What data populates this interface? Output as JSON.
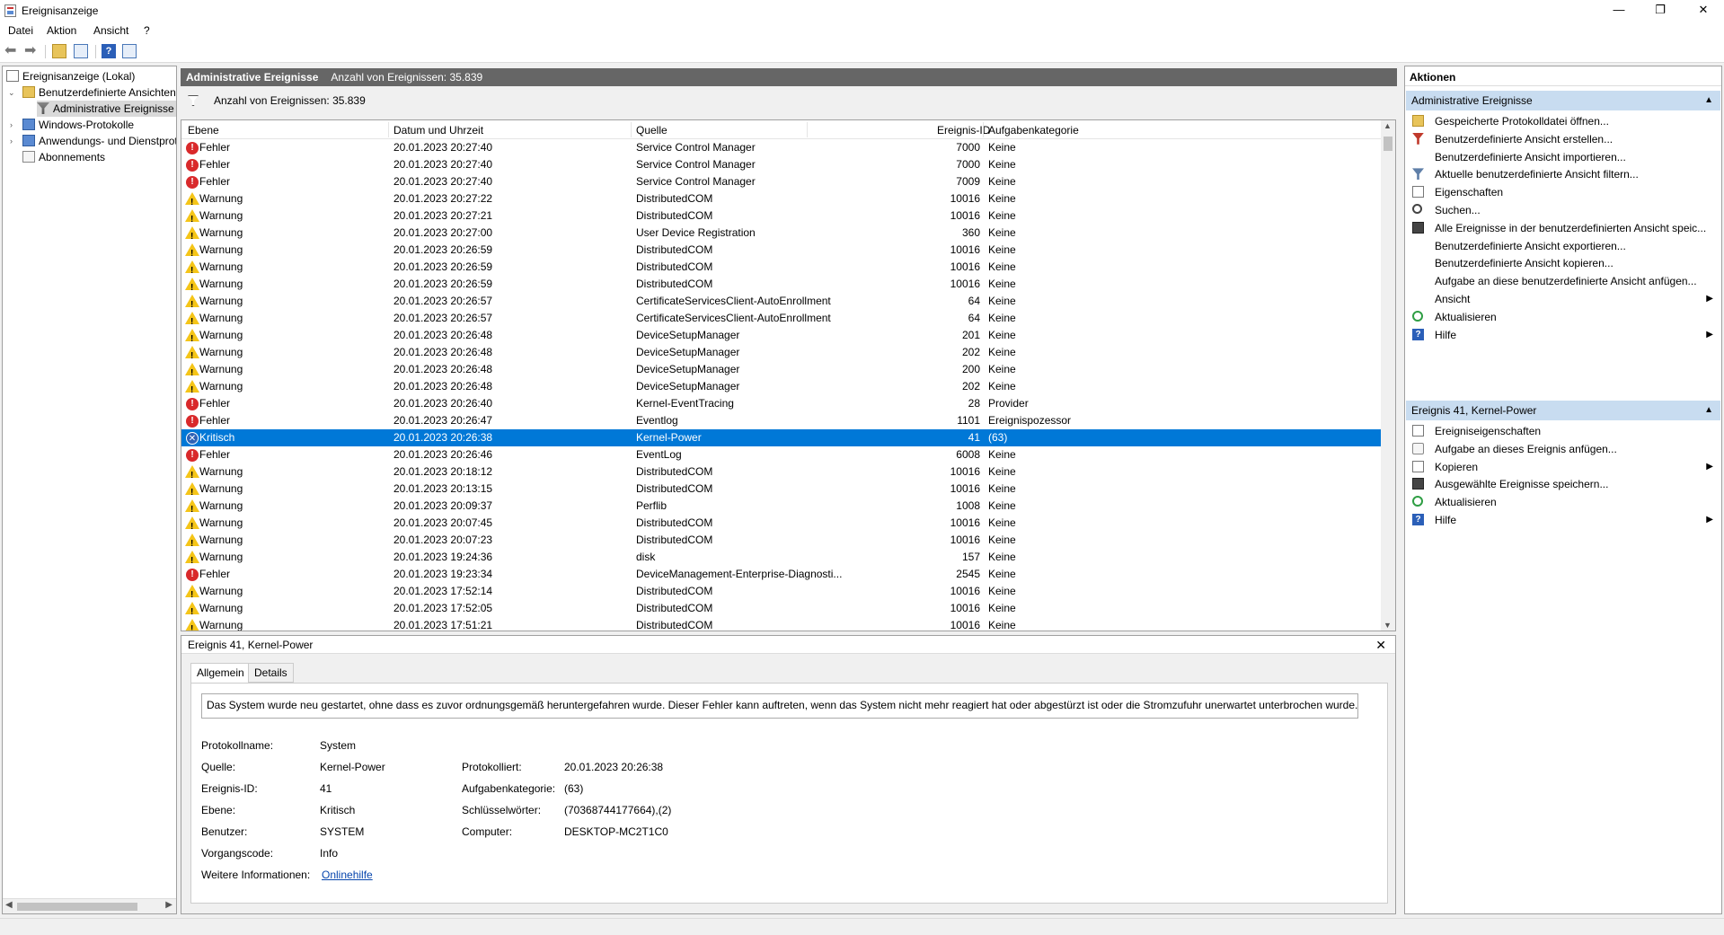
{
  "window": {
    "title": "Ereignisanzeige",
    "minimize": "—",
    "maximize": "❐",
    "close": "✕"
  },
  "menu": [
    "Datei",
    "Aktion",
    "Ansicht",
    "?"
  ],
  "tree": {
    "root": "Ereignisanzeige (Lokal)",
    "custom_views": "Benutzerdefinierte Ansichten",
    "admin_events": "Administrative Ereignisse",
    "windows_logs": "Windows-Protokolle",
    "app_logs": "Anwendungs- und Dienstprotokolle",
    "subscriptions": "Abonnements"
  },
  "center": {
    "header_title": "Administrative Ereignisse",
    "header_count": "Anzahl von Ereignissen: 35.839",
    "filter_text": "Anzahl von Ereignissen: 35.839",
    "columns": [
      "Ebene",
      "Datum und Uhrzeit",
      "Quelle",
      "Ereignis-ID",
      "Aufgabenkategorie"
    ],
    "rows": [
      {
        "level": "Fehler",
        "type": "err",
        "date": "20.01.2023 20:27:40",
        "source": "Service Control Manager",
        "id": "7000",
        "cat": "Keine"
      },
      {
        "level": "Fehler",
        "type": "err",
        "date": "20.01.2023 20:27:40",
        "source": "Service Control Manager",
        "id": "7000",
        "cat": "Keine"
      },
      {
        "level": "Fehler",
        "type": "err",
        "date": "20.01.2023 20:27:40",
        "source": "Service Control Manager",
        "id": "7009",
        "cat": "Keine"
      },
      {
        "level": "Warnung",
        "type": "warn",
        "date": "20.01.2023 20:27:22",
        "source": "DistributedCOM",
        "id": "10016",
        "cat": "Keine"
      },
      {
        "level": "Warnung",
        "type": "warn",
        "date": "20.01.2023 20:27:21",
        "source": "DistributedCOM",
        "id": "10016",
        "cat": "Keine"
      },
      {
        "level": "Warnung",
        "type": "warn",
        "date": "20.01.2023 20:27:00",
        "source": "User Device Registration",
        "id": "360",
        "cat": "Keine"
      },
      {
        "level": "Warnung",
        "type": "warn",
        "date": "20.01.2023 20:26:59",
        "source": "DistributedCOM",
        "id": "10016",
        "cat": "Keine"
      },
      {
        "level": "Warnung",
        "type": "warn",
        "date": "20.01.2023 20:26:59",
        "source": "DistributedCOM",
        "id": "10016",
        "cat": "Keine"
      },
      {
        "level": "Warnung",
        "type": "warn",
        "date": "20.01.2023 20:26:59",
        "source": "DistributedCOM",
        "id": "10016",
        "cat": "Keine"
      },
      {
        "level": "Warnung",
        "type": "warn",
        "date": "20.01.2023 20:26:57",
        "source": "CertificateServicesClient-AutoEnrollment",
        "id": "64",
        "cat": "Keine"
      },
      {
        "level": "Warnung",
        "type": "warn",
        "date": "20.01.2023 20:26:57",
        "source": "CertificateServicesClient-AutoEnrollment",
        "id": "64",
        "cat": "Keine"
      },
      {
        "level": "Warnung",
        "type": "warn",
        "date": "20.01.2023 20:26:48",
        "source": "DeviceSetupManager",
        "id": "201",
        "cat": "Keine"
      },
      {
        "level": "Warnung",
        "type": "warn",
        "date": "20.01.2023 20:26:48",
        "source": "DeviceSetupManager",
        "id": "202",
        "cat": "Keine"
      },
      {
        "level": "Warnung",
        "type": "warn",
        "date": "20.01.2023 20:26:48",
        "source": "DeviceSetupManager",
        "id": "200",
        "cat": "Keine"
      },
      {
        "level": "Warnung",
        "type": "warn",
        "date": "20.01.2023 20:26:48",
        "source": "DeviceSetupManager",
        "id": "202",
        "cat": "Keine"
      },
      {
        "level": "Fehler",
        "type": "err",
        "date": "20.01.2023 20:26:40",
        "source": "Kernel-EventTracing",
        "id": "28",
        "cat": "Provider"
      },
      {
        "level": "Fehler",
        "type": "err",
        "date": "20.01.2023 20:26:47",
        "source": "Eventlog",
        "id": "1101",
        "cat": "Ereignispozessor"
      },
      {
        "level": "Kritisch",
        "type": "crit",
        "date": "20.01.2023 20:26:38",
        "source": "Kernel-Power",
        "id": "41",
        "cat": "(63)",
        "selected": true
      },
      {
        "level": "Fehler",
        "type": "err",
        "date": "20.01.2023 20:26:46",
        "source": "EventLog",
        "id": "6008",
        "cat": "Keine"
      },
      {
        "level": "Warnung",
        "type": "warn",
        "date": "20.01.2023 20:18:12",
        "source": "DistributedCOM",
        "id": "10016",
        "cat": "Keine"
      },
      {
        "level": "Warnung",
        "type": "warn",
        "date": "20.01.2023 20:13:15",
        "source": "DistributedCOM",
        "id": "10016",
        "cat": "Keine"
      },
      {
        "level": "Warnung",
        "type": "warn",
        "date": "20.01.2023 20:09:37",
        "source": "Perflib",
        "id": "1008",
        "cat": "Keine"
      },
      {
        "level": "Warnung",
        "type": "warn",
        "date": "20.01.2023 20:07:45",
        "source": "DistributedCOM",
        "id": "10016",
        "cat": "Keine"
      },
      {
        "level": "Warnung",
        "type": "warn",
        "date": "20.01.2023 20:07:23",
        "source": "DistributedCOM",
        "id": "10016",
        "cat": "Keine"
      },
      {
        "level": "Warnung",
        "type": "warn",
        "date": "20.01.2023 19:24:36",
        "source": "disk",
        "id": "157",
        "cat": "Keine"
      },
      {
        "level": "Fehler",
        "type": "err",
        "date": "20.01.2023 19:23:34",
        "source": "DeviceManagement-Enterprise-Diagnosti...",
        "id": "2545",
        "cat": "Keine"
      },
      {
        "level": "Warnung",
        "type": "warn",
        "date": "20.01.2023 17:52:14",
        "source": "DistributedCOM",
        "id": "10016",
        "cat": "Keine"
      },
      {
        "level": "Warnung",
        "type": "warn",
        "date": "20.01.2023 17:52:05",
        "source": "DistributedCOM",
        "id": "10016",
        "cat": "Keine"
      },
      {
        "level": "Warnung",
        "type": "warn",
        "date": "20.01.2023 17:51:21",
        "source": "DistributedCOM",
        "id": "10016",
        "cat": "Keine"
      }
    ]
  },
  "detail": {
    "title": "Ereignis 41, Kernel-Power",
    "close": "✕",
    "tabs": [
      "Allgemein",
      "Details"
    ],
    "message": "Das System wurde neu gestartet, ohne dass es zuvor ordnungsgemäß heruntergefahren wurde. Dieser Fehler kann auftreten, wenn das System nicht mehr reagiert hat oder abgestürzt ist oder die Stromzufuhr unerwartet unterbrochen wurde.",
    "labels": {
      "logname": "Protokollname:",
      "source": "Quelle:",
      "eventid": "Ereignis-ID:",
      "level": "Ebene:",
      "user": "Benutzer:",
      "opcode": "Vorgangscode:",
      "moreinfo": "Weitere Informationen:",
      "logged": "Protokolliert:",
      "category": "Aufgabenkategorie:",
      "keywords": "Schlüsselwörter:",
      "computer": "Computer:"
    },
    "values": {
      "logname": "System",
      "source": "Kernel-Power",
      "eventid": "41",
      "level": "Kritisch",
      "user": "SYSTEM",
      "opcode": "Info",
      "moreinfo": "Onlinehilfe",
      "logged": "20.01.2023 20:26:38",
      "category": "(63)",
      "keywords": "(70368744177664),(2)",
      "computer": "DESKTOP-MC2T1C0"
    }
  },
  "actions": {
    "title": "Aktionen",
    "section1": "Administrative Ereignisse",
    "items1": [
      {
        "label": "Gespeicherte Protokolldatei öffnen...",
        "icon": "open"
      },
      {
        "label": "Benutzerdefinierte Ansicht erstellen...",
        "icon": "filter"
      },
      {
        "label": "Benutzerdefinierte Ansicht importieren...",
        "icon": ""
      },
      {
        "label": "Aktuelle benutzerdefinierte Ansicht filtern...",
        "icon": "filter2"
      },
      {
        "label": "Eigenschaften",
        "icon": "props"
      },
      {
        "label": "Suchen...",
        "icon": "find"
      },
      {
        "label": "Alle Ereignisse in der benutzerdefinierten Ansicht speic...",
        "icon": "save"
      },
      {
        "label": "Benutzerdefinierte Ansicht exportieren...",
        "icon": ""
      },
      {
        "label": "Benutzerdefinierte Ansicht kopieren...",
        "icon": ""
      },
      {
        "label": "Aufgabe an diese benutzerdefinierte Ansicht anfügen...",
        "icon": ""
      },
      {
        "label": "Ansicht",
        "icon": "",
        "sub": true
      },
      {
        "label": "Aktualisieren",
        "icon": "refresh"
      },
      {
        "label": "Hilfe",
        "icon": "help",
        "sub": true
      }
    ],
    "section2": "Ereignis 41, Kernel-Power",
    "items2": [
      {
        "label": "Ereigniseigenschaften",
        "icon": "props"
      },
      {
        "label": "Aufgabe an dieses Ereignis anfügen...",
        "icon": "task"
      },
      {
        "label": "Kopieren",
        "icon": "props",
        "sub": true
      },
      {
        "label": "Ausgewählte Ereignisse speichern...",
        "icon": "save"
      },
      {
        "label": "Aktualisieren",
        "icon": "refresh"
      },
      {
        "label": "Hilfe",
        "icon": "help",
        "sub": true
      }
    ]
  }
}
